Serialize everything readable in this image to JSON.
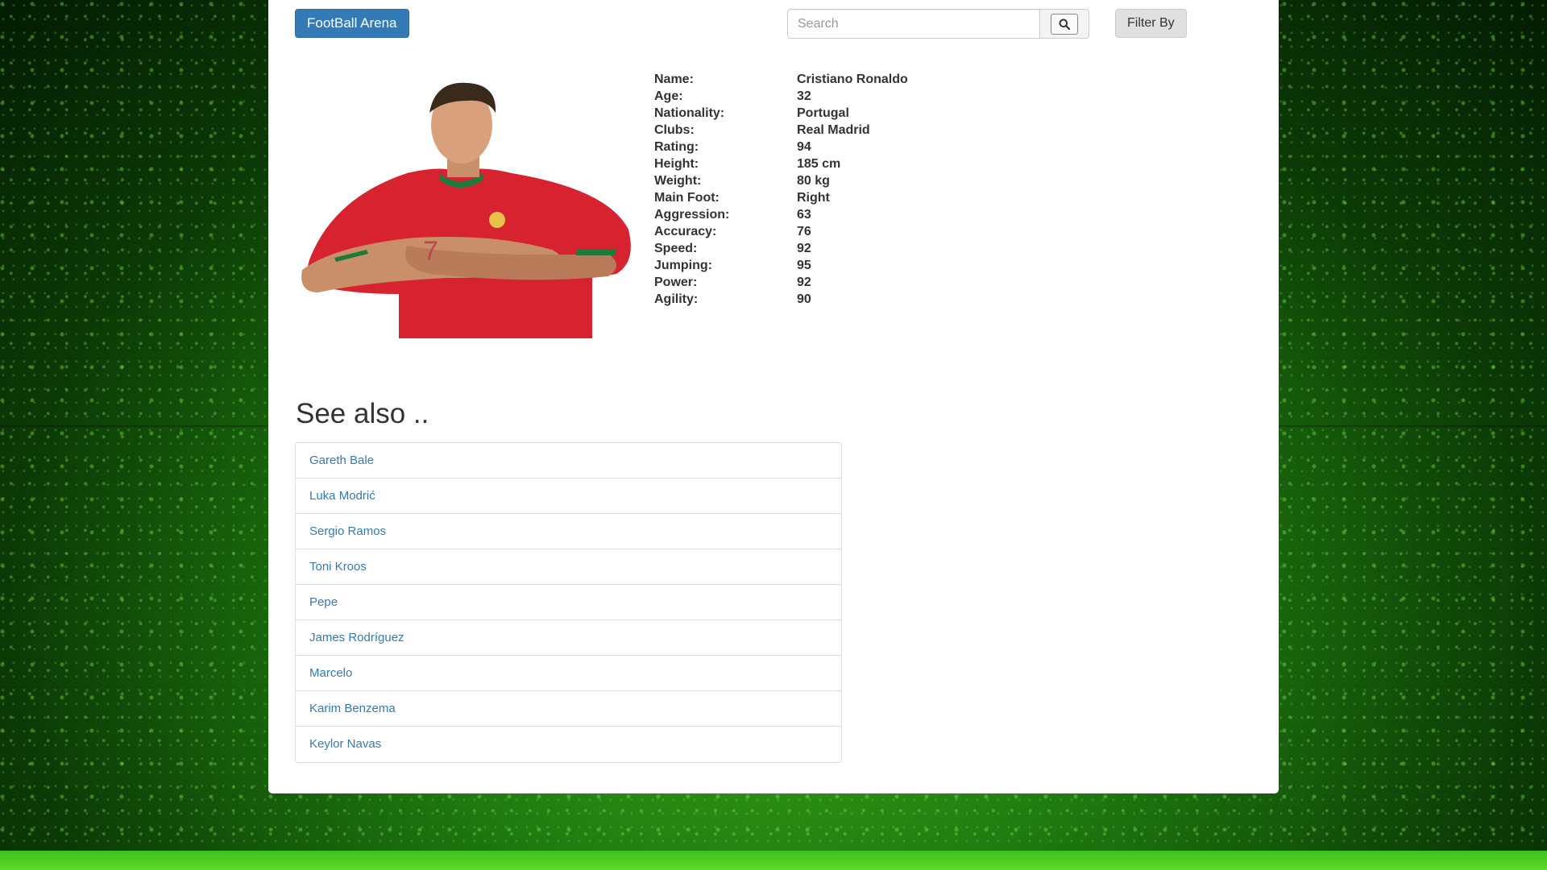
{
  "header": {
    "brand_label": "FootBall Arena",
    "search_placeholder": "Search",
    "search_icon": "search-icon",
    "filter_label": "Filter By"
  },
  "player": {
    "photo_description_icon": "player-photo",
    "stats": [
      {
        "label": "Name:",
        "value": "Cristiano Ronaldo"
      },
      {
        "label": "Age:",
        "value": "32"
      },
      {
        "label": "Nationality:",
        "value": "Portugal"
      },
      {
        "label": "Clubs:",
        "value": "Real Madrid"
      },
      {
        "label": "Rating:",
        "value": "94"
      },
      {
        "label": "Height:",
        "value": "185 cm"
      },
      {
        "label": "Weight:",
        "value": "80 kg"
      },
      {
        "label": "Main Foot:",
        "value": "Right"
      },
      {
        "label": "Aggression:",
        "value": "63"
      },
      {
        "label": "Accuracy:",
        "value": "76"
      },
      {
        "label": "Speed:",
        "value": "92"
      },
      {
        "label": "Jumping:",
        "value": "95"
      },
      {
        "label": "Power:",
        "value": "92"
      },
      {
        "label": "Agility:",
        "value": "90"
      }
    ]
  },
  "see_also": {
    "title": "See also ..",
    "items": [
      "Gareth Bale",
      "Luka Modrić",
      "Sergio Ramos",
      "Toni Kroos",
      "Pepe",
      "James Rodríguez",
      "Marcelo",
      "Karim Benzema",
      "Keylor Navas"
    ]
  },
  "colors": {
    "brand_button": "#337ab7",
    "link": "#337ab7",
    "background_green": "#1f7a10"
  }
}
